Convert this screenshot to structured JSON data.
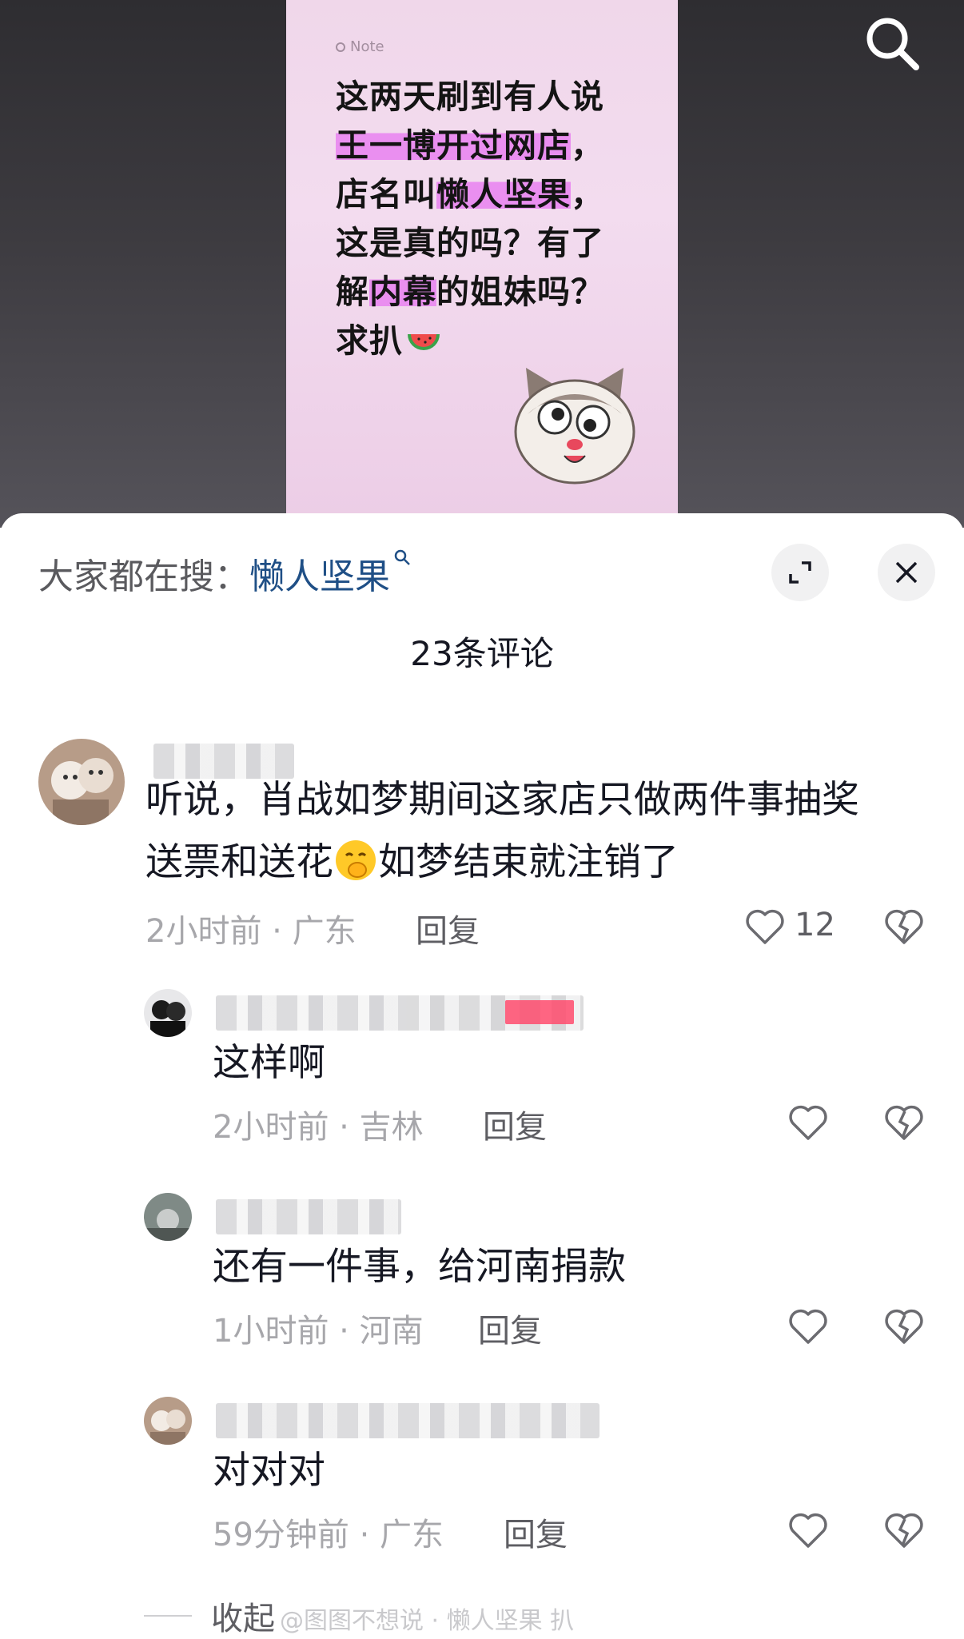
{
  "note": {
    "tag": "Note",
    "lines": [
      {
        "pre": "这两天刷到有人说",
        "hl": "",
        "post": ""
      },
      {
        "pre": "",
        "hl": "王一博开过网店",
        "post": "，"
      },
      {
        "pre": "店名叫",
        "hl": "懒人坚果",
        "post": "，"
      },
      {
        "pre": "这是真的吗？有了",
        "hl": "",
        "post": ""
      },
      {
        "pre": "解",
        "hl": "内幕",
        "post": "的姐妹吗？"
      },
      {
        "pre": "求扒",
        "hl": "",
        "post": ""
      }
    ]
  },
  "header": {
    "search_hint_label": "大家都在搜：",
    "search_hint_term": "懒人坚果",
    "comment_count": "23条评论"
  },
  "comments": [
    {
      "text_lines": [
        "听说，肖战如梦期间这家店只做两件事抽奖",
        "送票和送花",
        "如梦结束就注销了"
      ],
      "time": "2小时前 · 广东",
      "reply": "回复",
      "likes": "12"
    },
    {
      "text_lines": [
        "这样啊"
      ],
      "time": "2小时前 · 吉林",
      "reply": "回复",
      "likes": ""
    },
    {
      "text_lines": [
        "还有一件事，给河南捐款"
      ],
      "time": "1小时前 · 河南",
      "reply": "回复",
      "likes": ""
    },
    {
      "text_lines": [
        "对对对"
      ],
      "time": "59分钟前 · 广东",
      "reply": "回复",
      "likes": ""
    }
  ],
  "footer": {
    "collapse": "收起",
    "watermark": "@图图不想说 · 懒人坚果 扒"
  },
  "colors": {
    "highlight": "#ea8ff0",
    "search_term": "#1f4f86",
    "meta": "#a7a7ab"
  }
}
